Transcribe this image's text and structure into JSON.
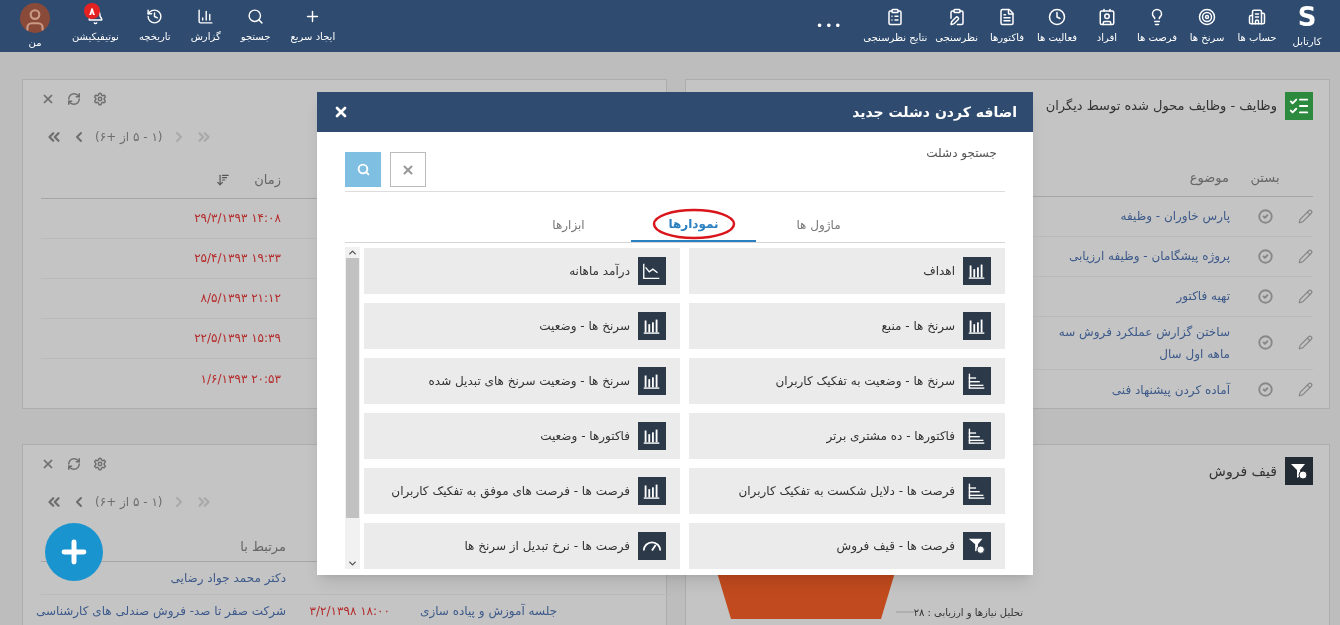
{
  "nav": {
    "logo": "S",
    "items": [
      {
        "label": "کارتابل"
      },
      {
        "label": "حساب ها"
      },
      {
        "label": "سرنخ ها"
      },
      {
        "label": "فرصت ها"
      },
      {
        "label": "افراد"
      },
      {
        "label": "فعالیت ها"
      },
      {
        "label": "فاکتورها"
      },
      {
        "label": "نظرسنجی"
      },
      {
        "label": "نتایج نظرسنجی"
      }
    ],
    "more": "•••",
    "tools": [
      {
        "label": "ایجاد سریع"
      },
      {
        "label": "جستجو"
      },
      {
        "label": "گزارش"
      },
      {
        "label": "تاریخچه"
      },
      {
        "label": "نوتیفیکیشن",
        "badge": "۸"
      }
    ],
    "profile": "من"
  },
  "tasks_panel": {
    "title": "وظایف - وظایف محول شده توسط دیگران",
    "columns": [
      "بستن",
      "موضوع"
    ],
    "rows": [
      {
        "subject": "پارس خاوران - وظیفه"
      },
      {
        "subject": "پروژه پیشگامان - وظیفه ارزیابی"
      },
      {
        "subject": "تهیه فاکتور"
      },
      {
        "subject": "ساختن گزارش عملکرد فروش سه ماهه اول سال"
      },
      {
        "subject": "آماده کردن پیشنهاد فنی"
      }
    ]
  },
  "events_panel": {
    "pager": "(۱ - ۵ از +۶)",
    "column": "زمان",
    "rows": [
      "۲۹/۳/۱۳۹۳ ۱۴:۰۸",
      "۲۵/۴/۱۳۹۳ ۱۹:۳۳",
      "۸/۵/۱۳۹۳ ۲۱:۱۲",
      "۲۲/۵/۱۳۹۳ ۱۵:۳۹",
      "۱/۶/۱۳۹۳ ۲۰:۵۳"
    ]
  },
  "funnel_panel": {
    "title": "قیف فروش",
    "labels": [
      "تحلیل نیازها و ارزیابی : ۲۸"
    ]
  },
  "meetings_panel": {
    "pager": "(۱ - ۵ از +۶)",
    "column": "مرتبط با",
    "rows": [
      {
        "related": "دکتر محمد جواد رضایی"
      },
      {
        "subject": "جلسه آموزش و پیاده سازی",
        "time": "۳/۲/۱۳۹۸ ۱۸:۰۰",
        "related": "شرکت صفر تا صد- فروش صندلی های کارشناسی"
      }
    ]
  },
  "dialog": {
    "title": "اضافه کردن دشلت جدید",
    "search_label": "جستجو دشلت",
    "tabs": [
      {
        "label": "ماژول ها",
        "selected": false
      },
      {
        "label": "نمودارها",
        "selected": true
      },
      {
        "label": "ابزارها",
        "selected": false
      }
    ],
    "items": [
      {
        "label": "اهداف",
        "kind": "bars"
      },
      {
        "label": "درآمد ماهانه",
        "kind": "line"
      },
      {
        "label": "سرنخ ها - منبع",
        "kind": "bars"
      },
      {
        "label": "سرنخ ها - وضعیت",
        "kind": "bars"
      },
      {
        "label": "سرنخ ها - وضعیت به تفکیک کاربران",
        "kind": "hbars"
      },
      {
        "label": "سرنخ ها - وضعیت سرنخ های تبدیل شده",
        "kind": "bars"
      },
      {
        "label": "فاکتورها - ده مشتری برتر",
        "kind": "hbars"
      },
      {
        "label": "فاکتورها - وضعیت",
        "kind": "bars"
      },
      {
        "label": "فرصت ها - دلایل شکست به تفکیک کاربران",
        "kind": "hbars"
      },
      {
        "label": "فرصت ها - فرصت های موفق به تفکیک کاربران",
        "kind": "bars"
      },
      {
        "label": "فرصت ها - قیف فروش",
        "kind": "funnel"
      },
      {
        "label": "فرصت ها - نرخ تبدیل از سرنخ ها",
        "kind": "gauge"
      }
    ]
  }
}
